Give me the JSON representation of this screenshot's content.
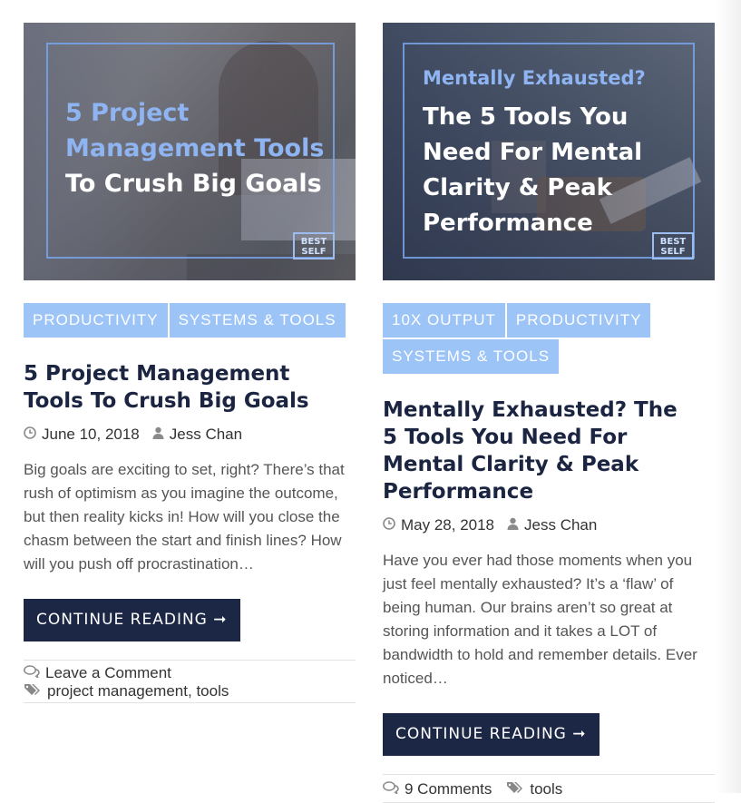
{
  "posts": [
    {
      "image": {
        "line1": "5 Project",
        "line2": "Management Tools",
        "line3": "To Crush Big Goals",
        "logo": "BEST SELF"
      },
      "tags": [
        "PRODUCTIVITY",
        "SYSTEMS & TOOLS"
      ],
      "title": "5 Project Management Tools To Crush Big Goals",
      "date": "June 10, 2018",
      "author": "Jess Chan",
      "excerpt": "Big goals are exciting to set, right? There’s that rush of optimism as you imagine the outcome, but then reality kicks in! How will you close the chasm between the start and finish lines? How will you push off procrastination…",
      "button": "CONTINUE READING ➞",
      "comments": "Leave a Comment",
      "post_tags": [
        "project management",
        "tools"
      ]
    },
    {
      "image": {
        "line1": "Mentally Exhausted?",
        "line2": "The 5 Tools You",
        "line3": "Need For Mental",
        "line4": "Clarity & Peak",
        "line5": "Performance",
        "logo": "BEST SELF"
      },
      "tags": [
        "10X OUTPUT",
        "PRODUCTIVITY",
        "SYSTEMS & TOOLS"
      ],
      "title": "Mentally Exhausted? The 5 Tools You Need For Mental Clarity & Peak Performance",
      "date": "May 28, 2018",
      "author": "Jess Chan",
      "excerpt": "Have you ever had those moments when you just feel mentally exhausted? It’s a ‘flaw’ of being human. Our brains aren’t so great at storing information and it takes a LOT of bandwidth to hold and remember details. Ever noticed…",
      "button": "CONTINUE READING ➞",
      "comments": "9 Comments",
      "post_tags": [
        "tools"
      ]
    }
  ],
  "colors": {
    "tag_bg": "#9cc4f7",
    "title": "#1b2440",
    "button_bg": "#1b2744",
    "image_accent": "#8fb4f2"
  },
  "icons": {
    "date": "clock-icon",
    "author": "user-icon",
    "comments": "comments-icon",
    "tags": "tags-icon"
  }
}
